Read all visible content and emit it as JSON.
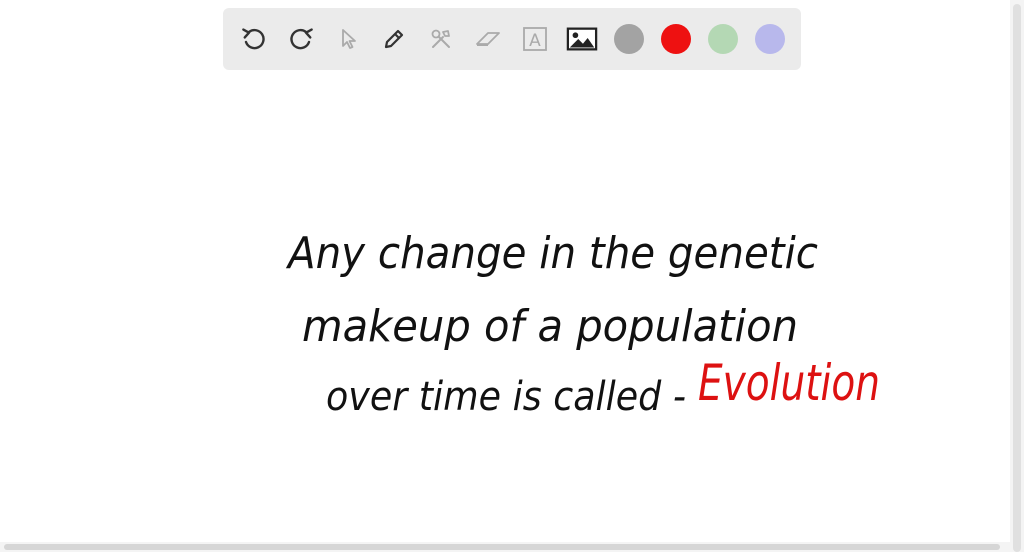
{
  "toolbar": {
    "tools": [
      {
        "icon": "undo-icon"
      },
      {
        "icon": "redo-icon"
      },
      {
        "icon": "pointer-icon"
      },
      {
        "icon": "pen-icon"
      },
      {
        "icon": "tools-icon"
      },
      {
        "icon": "eraser-icon"
      },
      {
        "icon": "text-icon",
        "glyph": "A"
      },
      {
        "icon": "image-icon"
      }
    ],
    "colors": [
      "#a3a3a3",
      "#ee1111",
      "#b4d8b4",
      "#b8b8ec"
    ]
  },
  "canvas": {
    "lines": [
      {
        "text": "Any change in the genetic",
        "color": "#111111"
      },
      {
        "text": "makeup of a population",
        "color": "#111111"
      },
      {
        "text": "over time is called -",
        "color": "#111111"
      }
    ],
    "answer": {
      "text": "Evolution",
      "color": "#dd1111"
    }
  }
}
